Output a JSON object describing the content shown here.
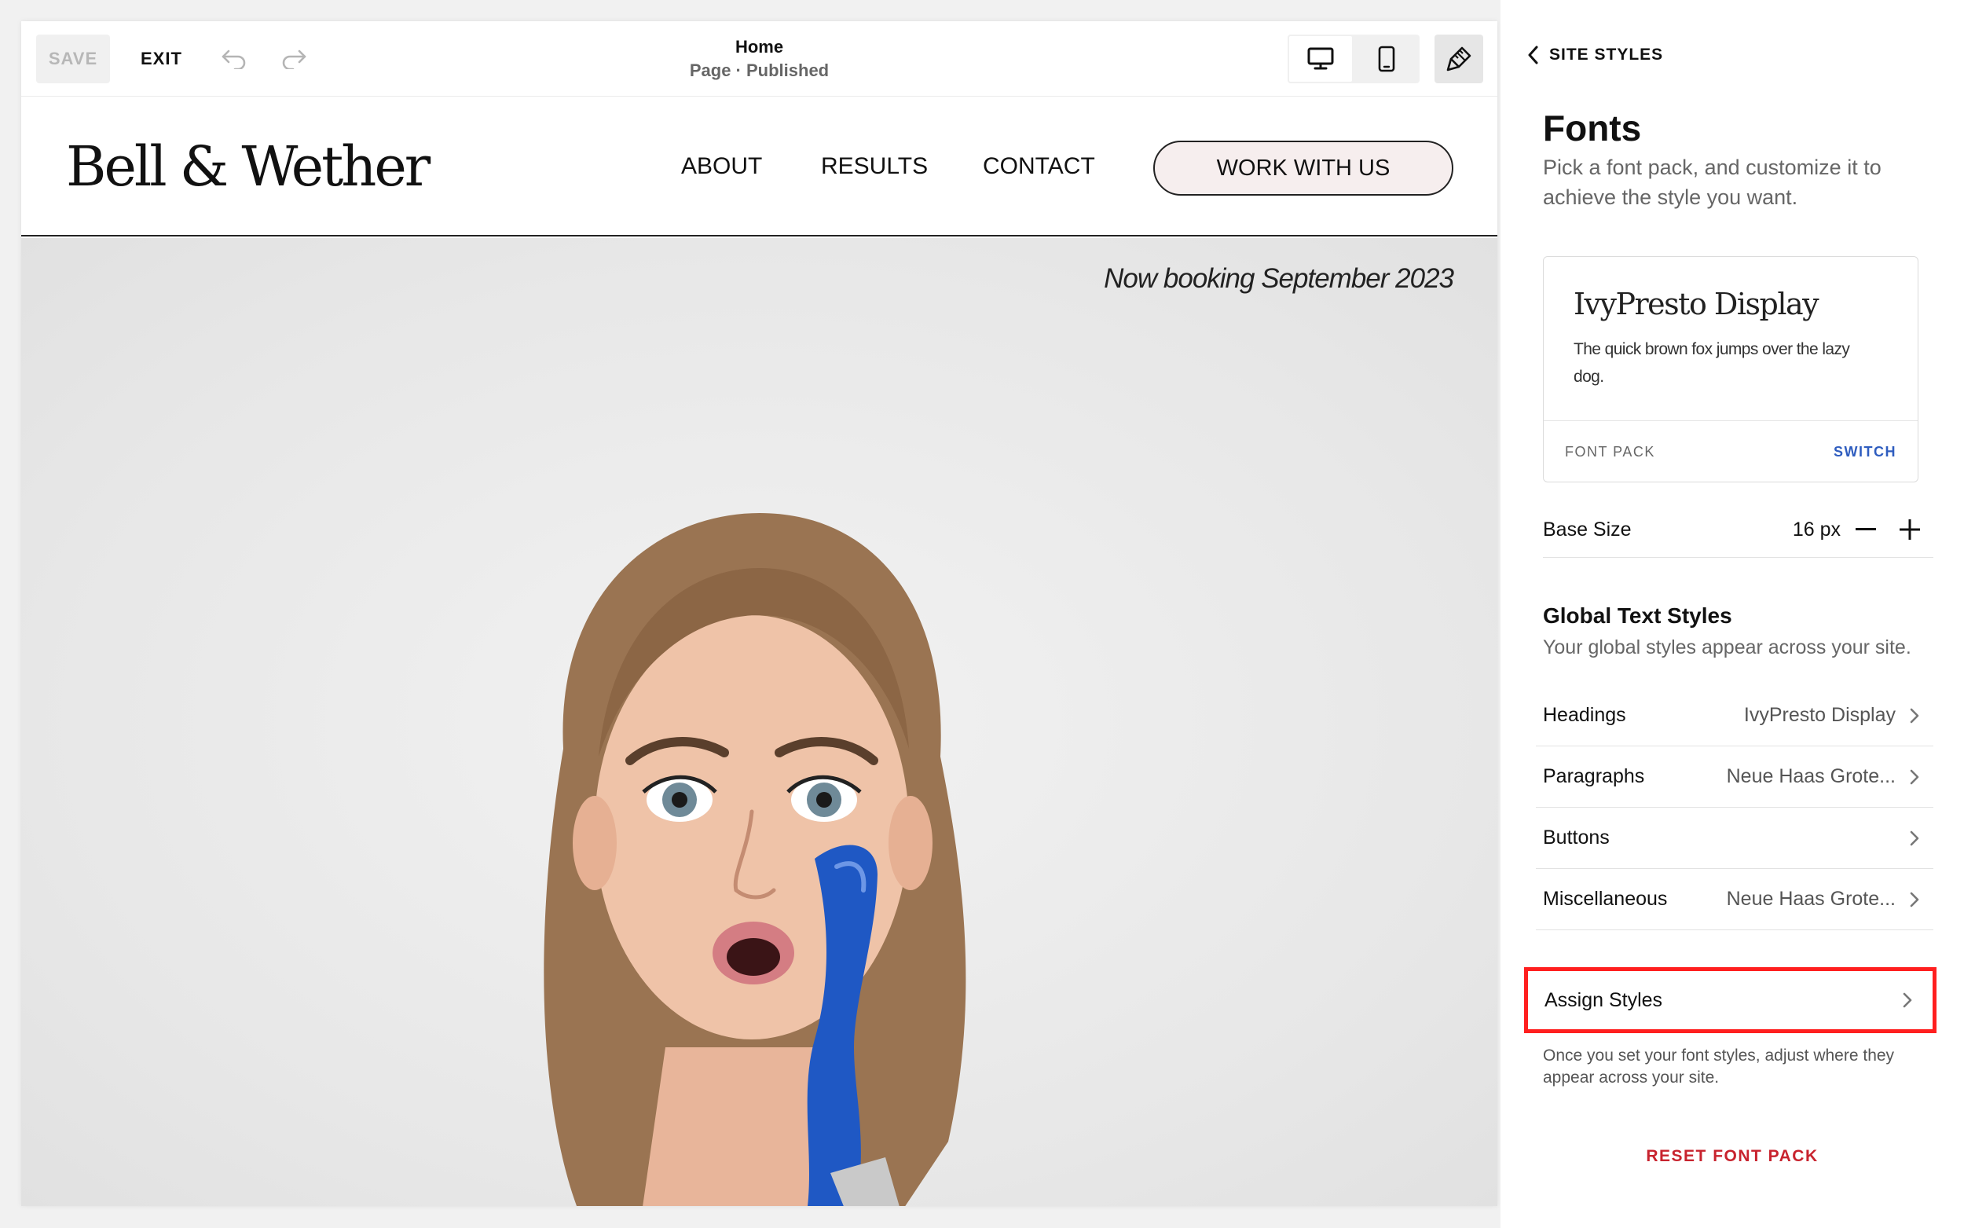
{
  "toolbar": {
    "save_label": "SAVE",
    "exit_label": "EXIT",
    "page_name": "Home",
    "page_status": "Page · Published",
    "undo_icon": "undo-icon",
    "redo_icon": "redo-icon",
    "desktop_icon": "desktop-icon",
    "mobile_icon": "mobile-icon",
    "style_icon": "paintbrush-icon"
  },
  "site": {
    "logo": "Bell & Wether",
    "nav": [
      "ABOUT",
      "RESULTS",
      "CONTACT"
    ],
    "cta": "WORK WITH US",
    "booking": "Now booking September 2023",
    "accent_button_bg": "#f6eeee"
  },
  "panel": {
    "back_label": "SITE STYLES",
    "title": "Fonts",
    "subtitle": "Pick a font pack, and customize it to achieve the style you want.",
    "font_pack": {
      "name": "IvyPresto Display",
      "sample": "The quick brown fox jumps over the lazy dog.",
      "label": "FONT PACK",
      "switch_label": "SWITCH"
    },
    "base_size": {
      "label": "Base Size",
      "value": "16 px"
    },
    "global_styles": {
      "title": "Global Text Styles",
      "subtitle": "Your global styles appear across your site.",
      "rows": [
        {
          "label": "Headings",
          "value": "IvyPresto Display"
        },
        {
          "label": "Paragraphs",
          "value": "Neue Haas Grote..."
        },
        {
          "label": "Buttons",
          "value": ""
        },
        {
          "label": "Miscellaneous",
          "value": "Neue Haas Grote..."
        }
      ]
    },
    "assign": {
      "label": "Assign Styles",
      "help": "Once you set your font styles, adjust where they appear across your site.",
      "highlight_color": "#ff1f1f"
    },
    "reset_label": "RESET FONT PACK",
    "switch_color": "#2f5dbf",
    "reset_color": "#c8232e"
  }
}
